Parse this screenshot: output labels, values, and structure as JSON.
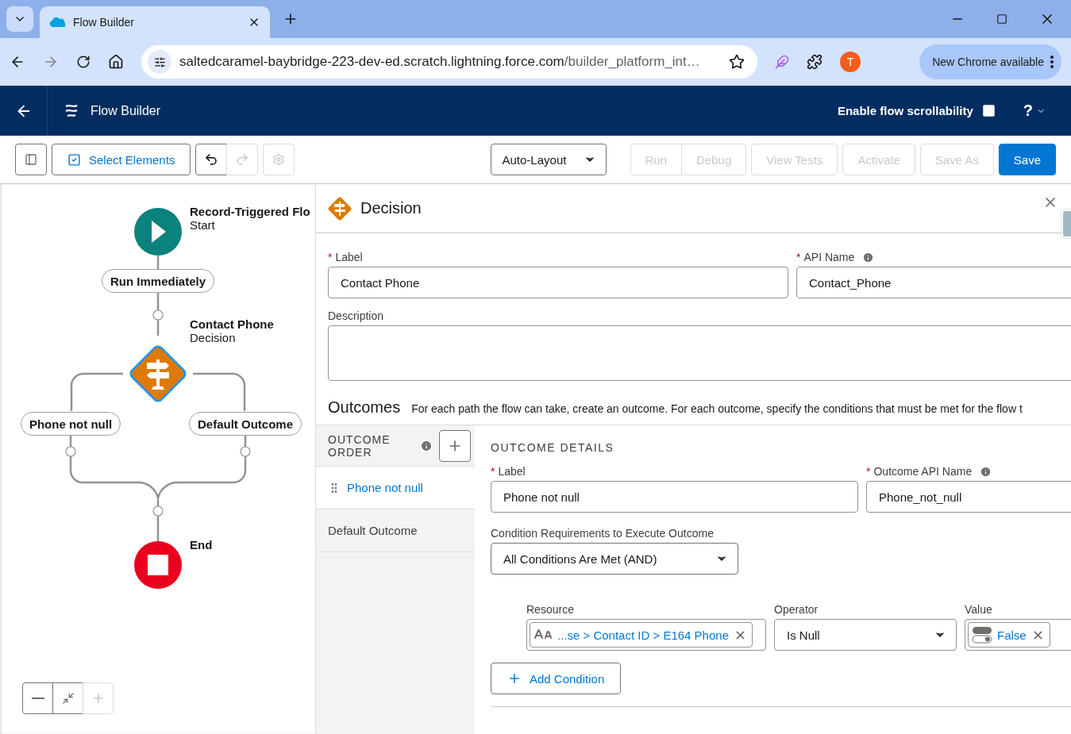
{
  "browser": {
    "tab_title": "Flow Builder",
    "url_host": "saltedcaramel-baybridge-223-dev-ed.scratch.lightning.force.com",
    "url_path": "/builder_platform_int…",
    "avatar": "T",
    "update_button": "New Chrome available"
  },
  "app_header": {
    "title": "Flow Builder",
    "scrollability": {
      "label": "Enable flow scrollability",
      "checked": false
    },
    "help": "?"
  },
  "toolbar": {
    "select_elements": "Select Elements",
    "layout": "Auto-Layout",
    "buttons": [
      {
        "label": "Run",
        "disabled": true
      },
      {
        "label": "Debug",
        "disabled": true
      },
      {
        "label": "View Tests",
        "disabled": true
      },
      {
        "label": "Activate",
        "disabled": true
      },
      {
        "label": "Save As",
        "disabled": true
      },
      {
        "label": "Save",
        "disabled": false
      }
    ]
  },
  "canvas": {
    "start": {
      "title": "Record-Triggered Flo",
      "subtitle": "Start"
    },
    "schedule": "Run Immediately",
    "decision": {
      "title": "Contact Phone",
      "subtitle": "Decision"
    },
    "branches": [
      "Phone not null",
      "Default Outcome"
    ],
    "end": {
      "title": "End"
    }
  },
  "panel": {
    "title": "Decision",
    "required_mark": "*",
    "label": {
      "label": "Label",
      "required": true,
      "value": "Contact Phone"
    },
    "api_name": {
      "label": "API Name",
      "required": true,
      "value": "Contact_Phone"
    },
    "description": {
      "label": "Description"
    },
    "outcomes_heading": "Outcomes",
    "outcomes_help": "For each path the flow can take, create an outcome. For each outcome, specify the conditions that must be met for the flow t",
    "outcome_order": "OUTCOME ORDER",
    "outcomes": [
      {
        "label": "Phone not null",
        "selected": true
      },
      {
        "label": "Default Outcome",
        "selected": false
      }
    ],
    "details": {
      "heading": "OUTCOME DETAILS",
      "label": {
        "label": "Label",
        "required": true,
        "value": "Phone not null"
      },
      "api_name": {
        "label": "Outcome API Name",
        "required": true,
        "value": "Phone_not_null"
      },
      "requirement_label": "Condition Requirements to Execute Outcome",
      "requirement": "All Conditions Are Met (AND)",
      "condition_headers": [
        "Resource",
        "Operator",
        "Value"
      ],
      "conditions": [
        {
          "resource": "...se > Contact ID > E164 Phone",
          "operator": "Is Null",
          "value": "False"
        }
      ],
      "add_condition": "Add Condition"
    }
  }
}
